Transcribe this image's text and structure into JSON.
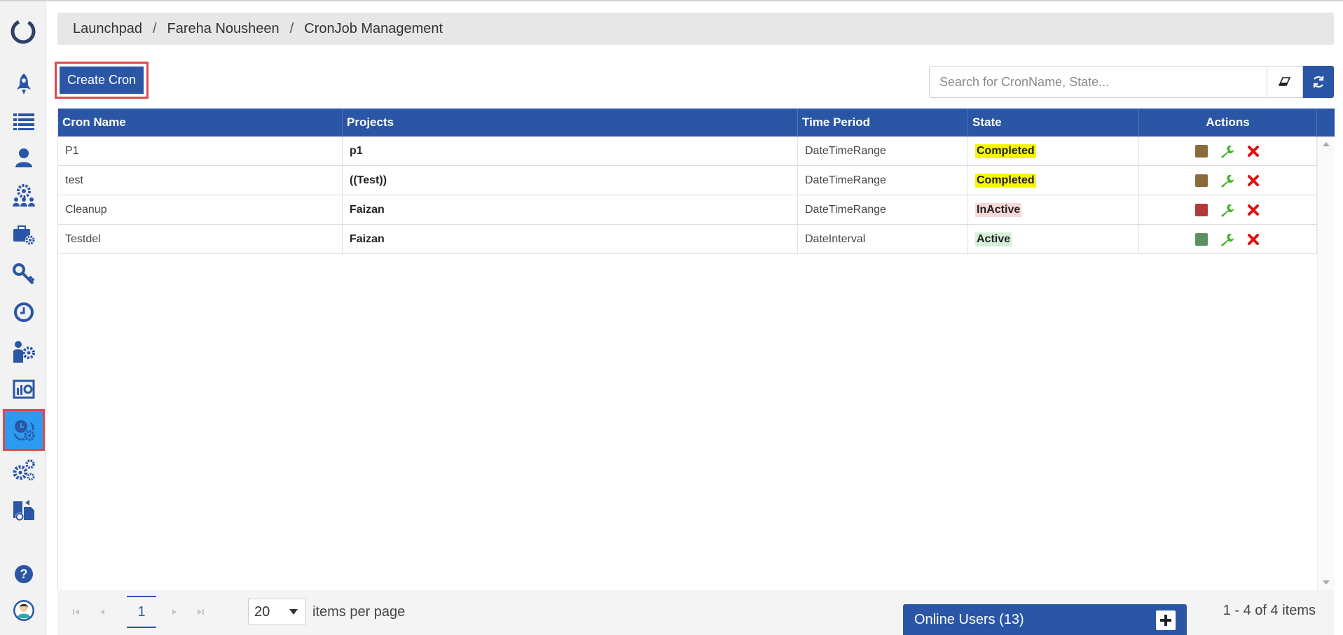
{
  "breadcrumb": [
    "Launchpad",
    "Fareha Nousheen",
    "CronJob Management"
  ],
  "breadcrumb_separator": "/",
  "toolbar": {
    "create_label": "Create Cron",
    "search_placeholder": "Search for CronName, State...",
    "search_value": ""
  },
  "table": {
    "columns": [
      "Cron Name",
      "Projects",
      "Time Period",
      "State",
      "Actions"
    ],
    "rows": [
      {
        "name": "P1",
        "project": "p1",
        "period": "DateTimeRange",
        "state": "Completed",
        "state_bg": "#f5f50a",
        "status_color": "#8b6b3d"
      },
      {
        "name": "test",
        "project": "((Test))",
        "period": "DateTimeRange",
        "state": "Completed",
        "state_bg": "#f5f50a",
        "status_color": "#8b6b3d"
      },
      {
        "name": "Cleanup",
        "project": "Faizan",
        "period": "DateTimeRange",
        "state": "InActive",
        "state_bg": "#f9d7d7",
        "status_color": "#b23a3a"
      },
      {
        "name": "Testdel",
        "project": "Faizan",
        "period": "DateInterval",
        "state": "Active",
        "state_bg": "#d4f0d8",
        "status_color": "#5a9161"
      }
    ]
  },
  "pager": {
    "current_page": "1",
    "page_size": "20",
    "items_per_page_label": "items per page",
    "info": "1 - 4 of 4 items"
  },
  "online_users": {
    "label": "Online Users (13)"
  },
  "colors": {
    "primary": "#2b56a6",
    "active_nav": "#2b9bf2",
    "highlight_border": "#e04848"
  },
  "sidebar_icons": [
    "launchpad-icon",
    "list-icon",
    "user-icon",
    "team-settings-icon",
    "briefcase-settings-icon",
    "keys-icon",
    "clock-icon",
    "people-settings-icon",
    "report-icon",
    "cronjob-icon",
    "gears-icon",
    "documents-icon",
    "help-icon",
    "profile-avatar-icon"
  ]
}
